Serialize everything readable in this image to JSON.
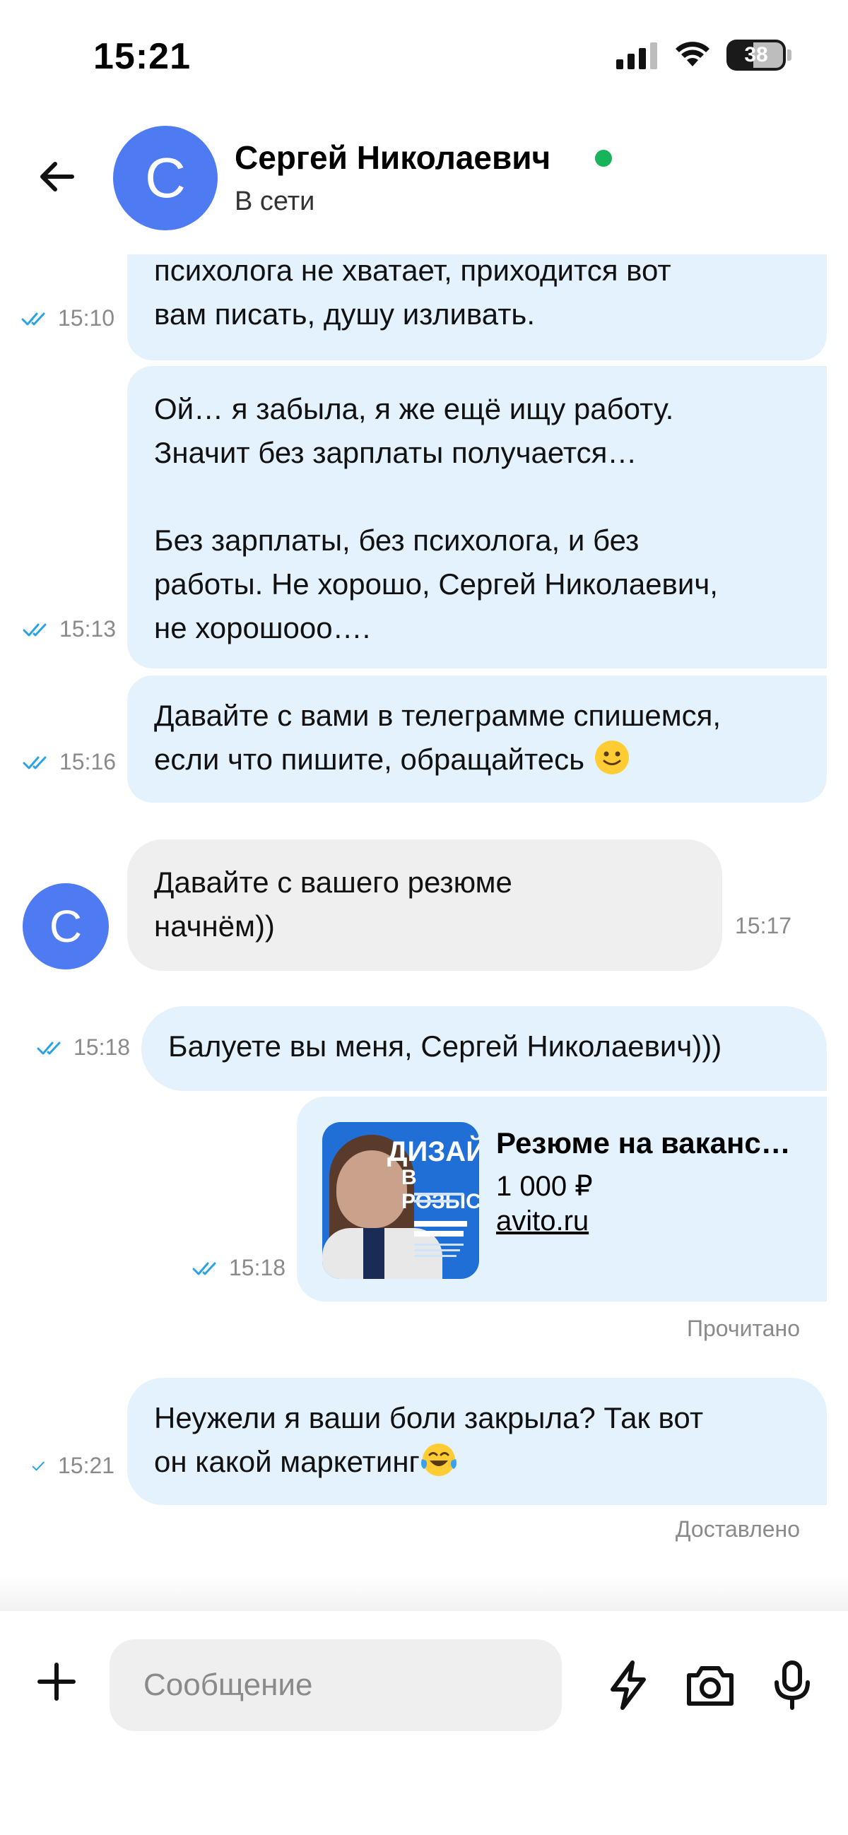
{
  "status_bar": {
    "time": "15:21",
    "battery": "38"
  },
  "header": {
    "contact_initial": "С",
    "contact_name": "Сергей Николаевич",
    "contact_status": "В сети"
  },
  "messages": [
    {
      "direction": "out",
      "lines": [
        "психолога не хватает, приходится вот",
        "вам писать, душу изливать."
      ],
      "time": "15:10",
      "read": true
    },
    {
      "direction": "out",
      "lines": [
        "Ой… я забыла, я же ещё ищу работу.",
        "Значит без зарплаты получается…",
        "",
        "Без зарплаты, без психолога, и без",
        "работы. Не хорошо, Сергей Николаевич,",
        "не хорошооо…."
      ],
      "time": "15:13",
      "read": true
    },
    {
      "direction": "out",
      "lines": [
        "Давайте с вами в телеграмме спишемся,",
        "если что пишите, обращайтесь"
      ],
      "emoji": "slight-smile-emoji",
      "time": "15:16",
      "read": true
    },
    {
      "direction": "in",
      "avatar_initial": "С",
      "lines": [
        "Давайте с вашего резюме",
        "начнём))"
      ],
      "time": "15:17"
    },
    {
      "direction": "out",
      "lines": [
        "Балуете вы меня, Сергей Николаевич)))"
      ],
      "time": "15:18",
      "read": true
    },
    {
      "direction": "out",
      "type": "link_card",
      "thumb_title": "ДИЗАЙНЕ",
      "thumb_subtitle": "В РОЗЫСК",
      "card_title": "Резюме на ваканс…",
      "card_price": "1 000 ₽",
      "card_link": "avito.ru",
      "time": "15:18",
      "read": true,
      "status_label": "Прочитано"
    },
    {
      "direction": "out",
      "lines": [
        "Неужели я ваши боли закрыла? Так вот",
        "он какой маркетинг"
      ],
      "emoji": "tears-of-joy-emoji",
      "time": "15:21",
      "read": false,
      "status_label": "Доставлено"
    }
  ],
  "composer": {
    "placeholder": "Сообщение"
  },
  "colors": {
    "accent": "#4f7bf2",
    "online": "#17b45c",
    "outgoing_bubble": "#e3f2fd",
    "incoming_bubble": "#efefef",
    "read_check": "#2aa3e6"
  }
}
